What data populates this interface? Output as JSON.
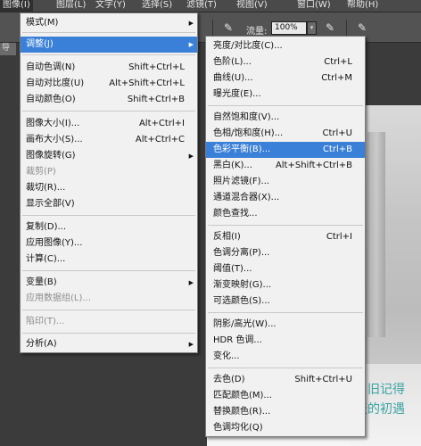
{
  "menubar": {
    "items": [
      "图像(I)",
      "图层(L)",
      "文字(Y)",
      "选择(S)",
      "滤镜(T)",
      "视图(V)",
      "窗口(W)",
      "帮助(H)"
    ]
  },
  "options_bar": {
    "flow_label": "流量:",
    "flow_value": "100%",
    "tab_label": "导"
  },
  "main_menu": {
    "items": [
      {
        "label": "模式(M)",
        "shortcut": "",
        "submenu": true,
        "disabled": false,
        "highlighted": false
      },
      {
        "label": "调整(J)",
        "shortcut": "",
        "submenu": true,
        "disabled": false,
        "highlighted": true
      },
      {
        "label": "自动色调(N)",
        "shortcut": "Shift+Ctrl+L",
        "submenu": false,
        "disabled": false,
        "highlighted": false
      },
      {
        "label": "自动对比度(U)",
        "shortcut": "Alt+Shift+Ctrl+L",
        "submenu": false,
        "disabled": false,
        "highlighted": false
      },
      {
        "label": "自动颜色(O)",
        "shortcut": "Shift+Ctrl+B",
        "submenu": false,
        "disabled": false,
        "highlighted": false
      },
      {
        "label": "图像大小(I)...",
        "shortcut": "Alt+Ctrl+I",
        "submenu": false,
        "disabled": false,
        "highlighted": false
      },
      {
        "label": "画布大小(S)...",
        "shortcut": "Alt+Ctrl+C",
        "submenu": false,
        "disabled": false,
        "highlighted": false
      },
      {
        "label": "图像旋转(G)",
        "shortcut": "",
        "submenu": true,
        "disabled": false,
        "highlighted": false
      },
      {
        "label": "裁剪(P)",
        "shortcut": "",
        "submenu": false,
        "disabled": true,
        "highlighted": false
      },
      {
        "label": "裁切(R)...",
        "shortcut": "",
        "submenu": false,
        "disabled": false,
        "highlighted": false
      },
      {
        "label": "显示全部(V)",
        "shortcut": "",
        "submenu": false,
        "disabled": false,
        "highlighted": false
      },
      {
        "label": "复制(D)...",
        "shortcut": "",
        "submenu": false,
        "disabled": false,
        "highlighted": false
      },
      {
        "label": "应用图像(Y)...",
        "shortcut": "",
        "submenu": false,
        "disabled": false,
        "highlighted": false
      },
      {
        "label": "计算(C)...",
        "shortcut": "",
        "submenu": false,
        "disabled": false,
        "highlighted": false
      },
      {
        "label": "变量(B)",
        "shortcut": "",
        "submenu": true,
        "disabled": false,
        "highlighted": false
      },
      {
        "label": "应用数据组(L)...",
        "shortcut": "",
        "submenu": false,
        "disabled": true,
        "highlighted": false
      },
      {
        "label": "陷印(T)...",
        "shortcut": "",
        "submenu": false,
        "disabled": true,
        "highlighted": false
      },
      {
        "label": "分析(A)",
        "shortcut": "",
        "submenu": true,
        "disabled": false,
        "highlighted": false
      }
    ]
  },
  "adjust_submenu": {
    "items": [
      {
        "label": "亮度/对比度(C)...",
        "shortcut": "",
        "highlighted": false
      },
      {
        "label": "色阶(L)...",
        "shortcut": "Ctrl+L",
        "highlighted": false
      },
      {
        "label": "曲线(U)...",
        "shortcut": "Ctrl+M",
        "highlighted": false
      },
      {
        "label": "曝光度(E)...",
        "shortcut": "",
        "highlighted": false
      },
      {
        "label": "自然饱和度(V)...",
        "shortcut": "",
        "highlighted": false
      },
      {
        "label": "色相/饱和度(H)...",
        "shortcut": "Ctrl+U",
        "highlighted": false
      },
      {
        "label": "色彩平衡(B)...",
        "shortcut": "Ctrl+B",
        "highlighted": true
      },
      {
        "label": "黑白(K)...",
        "shortcut": "Alt+Shift+Ctrl+B",
        "highlighted": false
      },
      {
        "label": "照片滤镜(F)...",
        "shortcut": "",
        "highlighted": false
      },
      {
        "label": "通道混合器(X)...",
        "shortcut": "",
        "highlighted": false
      },
      {
        "label": "颜色查找...",
        "shortcut": "",
        "highlighted": false
      },
      {
        "label": "反相(I)",
        "shortcut": "Ctrl+I",
        "highlighted": false
      },
      {
        "label": "色调分离(P)...",
        "shortcut": "",
        "highlighted": false
      },
      {
        "label": "阈值(T)...",
        "shortcut": "",
        "highlighted": false
      },
      {
        "label": "渐变映射(G)...",
        "shortcut": "",
        "highlighted": false
      },
      {
        "label": "可选颜色(S)...",
        "shortcut": "",
        "highlighted": false
      },
      {
        "label": "阴影/高光(W)...",
        "shortcut": "",
        "highlighted": false
      },
      {
        "label": "HDR 色调...",
        "shortcut": "",
        "highlighted": false
      },
      {
        "label": "变化...",
        "shortcut": "",
        "highlighted": false
      },
      {
        "label": "去色(D)",
        "shortcut": "Shift+Ctrl+U",
        "highlighted": false
      },
      {
        "label": "匹配颜色(M)...",
        "shortcut": "",
        "highlighted": false
      },
      {
        "label": "替换颜色(R)...",
        "shortcut": "",
        "highlighted": false
      },
      {
        "label": "色调均化(Q)",
        "shortcut": "",
        "highlighted": false
      }
    ]
  },
  "canvas": {
    "photo_text_1": "旧记得",
    "photo_text_2": "天的初遇"
  },
  "colors": {
    "menu_highlight": "#3b80d8",
    "menu_bg": "#f1f1f1",
    "app_bg": "#3b3b3b",
    "photo_text": "#3aa3a3"
  }
}
